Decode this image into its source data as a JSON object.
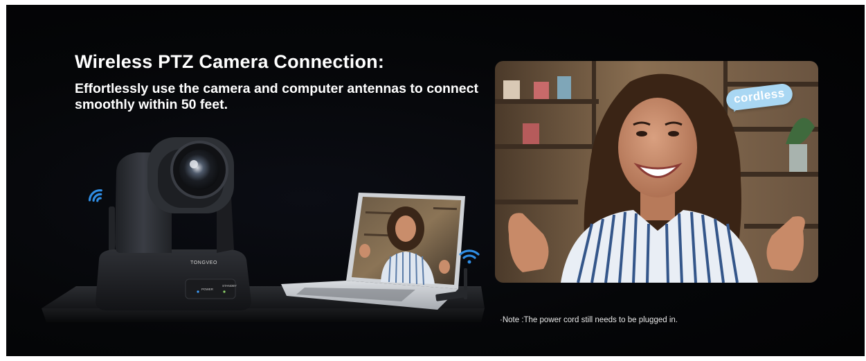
{
  "heading": "Wireless PTZ Camera Connection:",
  "subheading": "Effortlessly use the camera and computer antennas to connect smoothly within 50 feet.",
  "badge": "cordless",
  "note": "·Note :The power cord still needs to be plugged in.",
  "camera": {
    "brand": "TONGVEO",
    "power_label": "POWER",
    "standby_label": "STANDBY"
  },
  "colors": {
    "background": "#050608",
    "wifi_icon": "#2f8de4",
    "badge": "#a9d7f3"
  }
}
